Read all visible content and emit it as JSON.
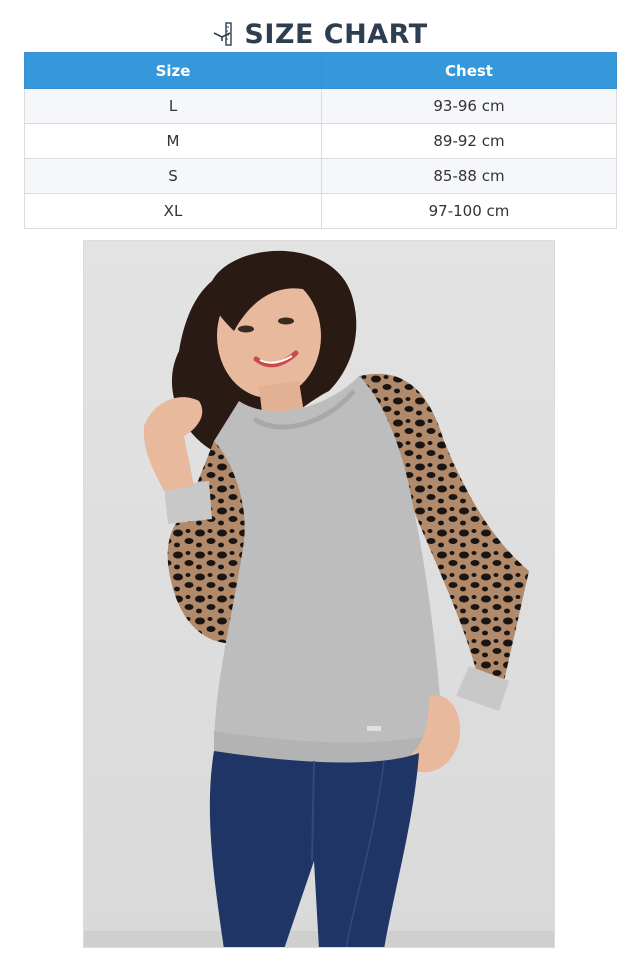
{
  "title": "SIZE CHART",
  "title_icon": "hanger-measure-icon",
  "table": {
    "headers": [
      "Size",
      "Chest"
    ],
    "rows": [
      {
        "size": "L",
        "chest": "93-96 cm"
      },
      {
        "size": "M",
        "chest": "89-92 cm"
      },
      {
        "size": "S",
        "chest": "85-88 cm"
      },
      {
        "size": "XL",
        "chest": "97-100 cm"
      }
    ]
  },
  "colors": {
    "header_bg": "#3498db",
    "title": "#2c3e50",
    "sweater": "#bdbdbd",
    "jeans": "#1f3565",
    "lace": "#1a1512",
    "hair": "#2a1a14"
  },
  "photo": {
    "subject": "model-wearing-grey-sweater-with-leopard-lace-sleeves"
  }
}
